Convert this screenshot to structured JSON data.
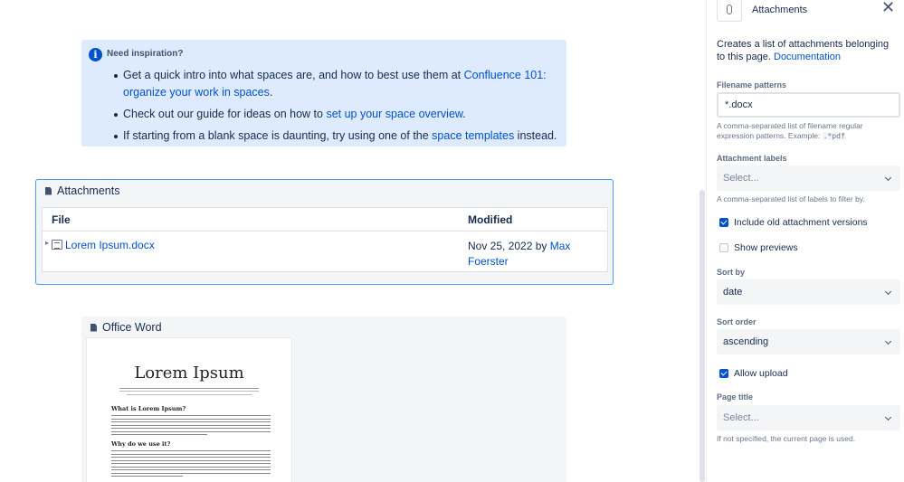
{
  "info_panel": {
    "title": "Need inspiration?",
    "items": [
      {
        "before": "Get a quick intro into what spaces are, and how to best use them at ",
        "link": "Confluence 101: organize your work in spaces",
        "after": "."
      },
      {
        "before": "Check out our guide for ideas on how to ",
        "link": "set up your space overview",
        "after": "."
      },
      {
        "before": "If starting from a blank space is daunting, try using one of the ",
        "link": "space templates",
        "after": " instead."
      }
    ]
  },
  "attachments_macro": {
    "title": "Attachments",
    "columns": {
      "file": "File",
      "modified": "Modified"
    },
    "rows": [
      {
        "file": "Lorem Ipsum.docx",
        "date": "Nov 25, 2022 by ",
        "author": "Max Foerster"
      }
    ]
  },
  "word_macro": {
    "title": "Office Word",
    "preview": {
      "doc_title": "Lorem Ipsum",
      "heading1": "What is Lorem Ipsum?",
      "heading2": "Why do we use it?"
    }
  },
  "sidebar": {
    "title": "Attachments",
    "icon": "paperclip-icon",
    "close_icon": "close-icon",
    "description": "Creates a list of attachments belonging to this page.",
    "doc_link": "Documentation",
    "filename_patterns": {
      "label": "Filename patterns",
      "value": "*.docx",
      "help_before": "A comma-separated list of filename regular expression patterns. Example: ",
      "help_code": ".*pdf"
    },
    "attachment_labels": {
      "label": "Attachment labels",
      "placeholder": "Select...",
      "help": "A comma-separated list of labels to filter by."
    },
    "include_old": {
      "label": "Include old attachment versions",
      "checked": true
    },
    "show_previews": {
      "label": "Show previews",
      "checked": false
    },
    "sort_by": {
      "label": "Sort by",
      "value": "date"
    },
    "sort_order": {
      "label": "Sort order",
      "value": "ascending"
    },
    "allow_upload": {
      "label": "Allow upload",
      "checked": true
    },
    "page_title": {
      "label": "Page title",
      "placeholder": "Select...",
      "help": "If not specified, the current page is used."
    }
  },
  "colors": {
    "link": "#0052cc",
    "info_bg": "#deebff",
    "checkbox_on": "#0052cc",
    "selection_border": "#4c9aff"
  }
}
